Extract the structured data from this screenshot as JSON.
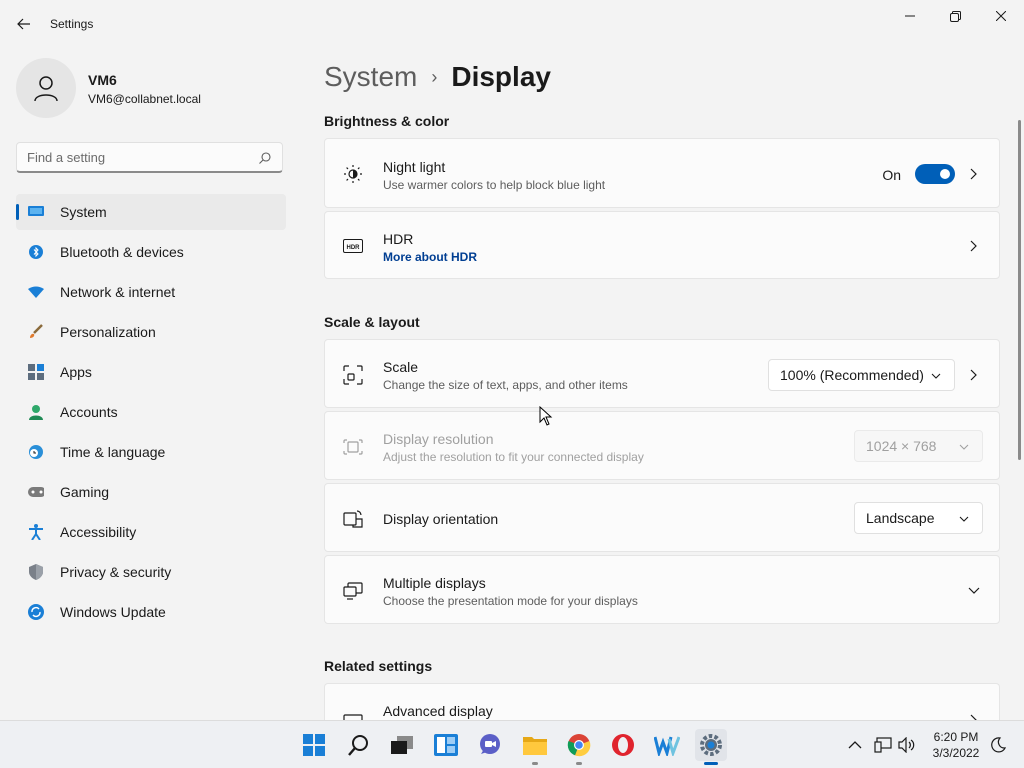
{
  "app": {
    "title": "Settings"
  },
  "window": {
    "minimize_icon": "minimize-icon",
    "maximize_icon": "restore-icon",
    "close_icon": "close-icon"
  },
  "profile": {
    "name": "VM6",
    "email": "VM6@collabnet.local"
  },
  "search": {
    "placeholder": "Find a setting"
  },
  "sidebar": {
    "items": [
      {
        "label": "System",
        "icon": "system-icon",
        "active": true
      },
      {
        "label": "Bluetooth & devices",
        "icon": "bluetooth-icon"
      },
      {
        "label": "Network & internet",
        "icon": "wifi-icon"
      },
      {
        "label": "Personalization",
        "icon": "brush-icon"
      },
      {
        "label": "Apps",
        "icon": "apps-icon"
      },
      {
        "label": "Accounts",
        "icon": "person-icon"
      },
      {
        "label": "Time & language",
        "icon": "clock-globe-icon"
      },
      {
        "label": "Gaming",
        "icon": "gamepad-icon"
      },
      {
        "label": "Accessibility",
        "icon": "accessibility-icon"
      },
      {
        "label": "Privacy & security",
        "icon": "shield-icon"
      },
      {
        "label": "Windows Update",
        "icon": "update-icon"
      }
    ]
  },
  "breadcrumb": {
    "parent": "System",
    "separator": "›",
    "current": "Display"
  },
  "sections": {
    "brightness": "Brightness & color",
    "scale_layout": "Scale & layout",
    "related": "Related settings"
  },
  "night_light": {
    "title": "Night light",
    "subtitle": "Use warmer colors to help block blue light",
    "state": "On",
    "enabled": true
  },
  "hdr": {
    "title": "HDR",
    "link": "More about HDR"
  },
  "scale": {
    "title": "Scale",
    "subtitle": "Change the size of text, apps, and other items",
    "value": "100% (Recommended)"
  },
  "resolution": {
    "title": "Display resolution",
    "subtitle": "Adjust the resolution to fit your connected display",
    "value": "1024 × 768",
    "disabled": true
  },
  "orientation": {
    "title": "Display orientation",
    "value": "Landscape"
  },
  "multiple": {
    "title": "Multiple displays",
    "subtitle": "Choose the presentation mode for your displays"
  },
  "advanced": {
    "title": "Advanced display"
  },
  "taskbar": {
    "apps": [
      "start-icon",
      "search-icon",
      "task-view-icon",
      "widgets-icon",
      "chat-icon",
      "file-explorer-icon",
      "chrome-icon",
      "opera-icon",
      "word-icon",
      "settings-icon"
    ],
    "time": "6:20 PM",
    "date": "3/3/2022"
  },
  "colors": {
    "accent": "#005fb8",
    "background": "#f3f3f3",
    "card": "#fbfbfb",
    "link": "#003e92"
  }
}
